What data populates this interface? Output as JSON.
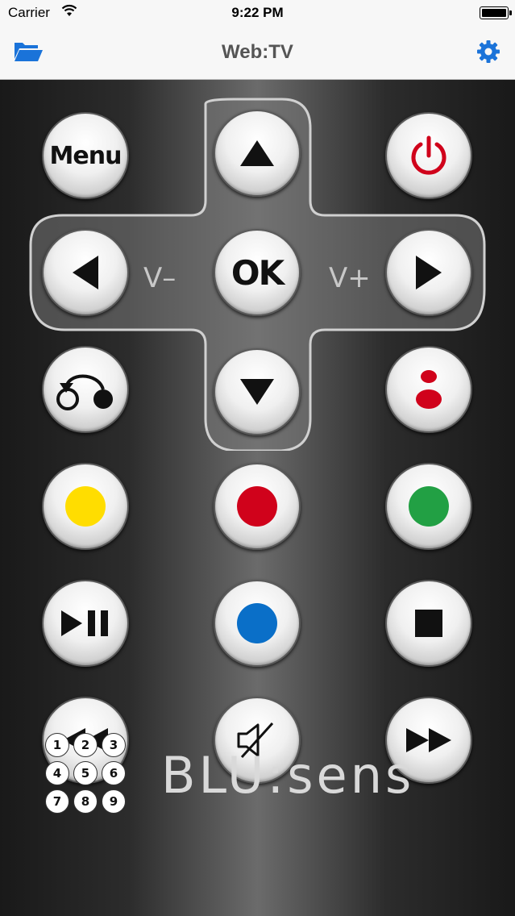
{
  "status_bar": {
    "carrier": "Carrier",
    "time": "9:22 PM"
  },
  "nav_bar": {
    "title": "Web:TV",
    "left_icon": "folder-icon",
    "right_icon": "gear-icon",
    "accent": "#1a73d9"
  },
  "remote": {
    "menu_label": "Menu",
    "ok_label": "OK",
    "vol_down_label": "V–",
    "vol_up_label": "V+",
    "power_color": "#d0021b",
    "color_buttons": {
      "yellow": "#ffdd00",
      "red": "#d0021b",
      "green": "#22a044",
      "blue": "#0a6fc8"
    },
    "numpad": [
      "1",
      "2",
      "3",
      "4",
      "5",
      "6",
      "7",
      "8",
      "9"
    ],
    "brand": "BLU:sens"
  }
}
